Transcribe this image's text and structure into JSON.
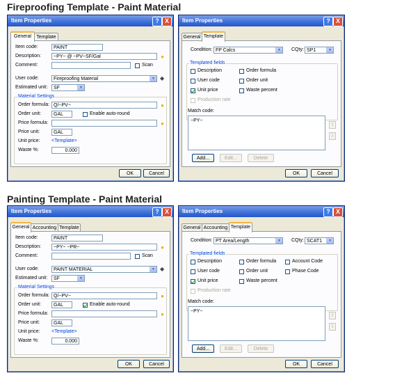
{
  "sections": {
    "fireproofing_title": "Fireproofing Template - Paint Material",
    "painting_title": "Painting Template - Paint Material"
  },
  "window_title": "Item Properties",
  "titlebar_buttons": {
    "help": "?",
    "close": "X"
  },
  "icons": {
    "help": "question-mark",
    "close": "x-close",
    "bulb": "lightbulb-icon",
    "pencil": "edit-pencil-icon",
    "up": "arrow-up-icon",
    "down": "arrow-down-icon",
    "dropdown": "chevron-down-icon"
  },
  "colors": {
    "titlebar": "#2556c9",
    "group_label": "#0046d5",
    "active_tab_accent": "#f5b53c",
    "dialog_bg": "#ece9d8"
  },
  "fp_general": {
    "tabs": [
      "General",
      "Template"
    ],
    "labels": {
      "item_code": "Item code:",
      "description": "Description:",
      "comment": "Comment:",
      "scan": "Scan",
      "user_code": "User code:",
      "estimated_unit": "Estimated unit:",
      "material_settings": "Material Settings",
      "order_formula": "Order formula:",
      "order_unit": "Order unit:",
      "enable_autoround": "Enable auto-round",
      "price_formula": "Price formula:",
      "price_unit": "Price unit:",
      "unit_price": "Unit price:",
      "waste": "Waste %:"
    },
    "values": {
      "item_code": "PAINT",
      "description": "~PY~ @ ~PV~SF/Gal",
      "comment": "",
      "user_code": "Fireproofing Material",
      "estimated_unit": "SF",
      "order_formula": "Q/~PV~",
      "order_unit": "GAL",
      "price_formula": "",
      "price_unit": "GAL",
      "unit_price": "<Template>",
      "waste": "0.000"
    },
    "checks": {
      "scan": false,
      "enable_autoround": false
    },
    "buttons": {
      "ok": "OK",
      "cancel": "Cancel"
    }
  },
  "fp_template": {
    "tabs": [
      "General",
      "Template"
    ],
    "labels": {
      "condition": "Condition:",
      "cqty": "CQty:",
      "templated_fields": "Templated fields",
      "description": "Description",
      "order_formula": "Order formula",
      "user_code": "User code",
      "order_unit": "Order unit",
      "unit_price": "Unit price",
      "waste_percent": "Waste percent",
      "production_rate": "Production rate",
      "match_code": "Match code:"
    },
    "values": {
      "condition": "FP Calcs",
      "cqty": "SP1",
      "match_code": "~PY~"
    },
    "checks": {
      "description": false,
      "order_formula": false,
      "user_code": false,
      "order_unit": false,
      "unit_price": true,
      "waste_percent": false,
      "production_rate": false
    },
    "buttons": {
      "add": "Add...",
      "edit": "Edit...",
      "delete": "Delete",
      "ok": "OK",
      "cancel": "Cancel"
    }
  },
  "pt_general": {
    "tabs": [
      "General",
      "Accounting",
      "Template"
    ],
    "labels": {
      "item_code": "Item code:",
      "description": "Description:",
      "comment": "Comment:",
      "scan": "Scan",
      "user_code": "User code:",
      "estimated_unit": "Estimated unit:",
      "material_settings": "Material Settings",
      "order_formula": "Order formula:",
      "order_unit": "Order unit:",
      "enable_autoround": "Enable auto-round",
      "price_formula": "Price formula:",
      "price_unit": "Price unit:",
      "unit_price": "Unit price:",
      "waste": "Waste %:"
    },
    "values": {
      "item_code": "PAINT",
      "description": "~PY~ ~PR~",
      "comment": "",
      "user_code": "PAINT MATERIAL",
      "estimated_unit": "SF",
      "order_formula": "Q/~PV~",
      "order_unit": "GAL",
      "price_formula": "",
      "price_unit": "GAL",
      "unit_price": "<Template>",
      "waste": "0.000"
    },
    "checks": {
      "scan": false,
      "enable_autoround": true
    },
    "buttons": {
      "ok": "OK",
      "cancel": "Cancel"
    }
  },
  "pt_template": {
    "tabs": [
      "General",
      "Accounting",
      "Template"
    ],
    "labels": {
      "condition": "Condition:",
      "cqty": "CQty:",
      "templated_fields": "Templated fields",
      "description": "Description",
      "order_formula": "Order formula",
      "account_code": "Account Code",
      "user_code": "User code",
      "order_unit": "Order unit",
      "phase_code": "Phase Code",
      "unit_price": "Unit price",
      "waste_percent": "Waste percent",
      "production_rate": "Production rate",
      "match_code": "Match code:"
    },
    "values": {
      "condition": "PT Area/Length",
      "cqty": "SCAT1",
      "match_code": "~PY~"
    },
    "checks": {
      "description": false,
      "order_formula": false,
      "account_code": false,
      "user_code": false,
      "order_unit": false,
      "phase_code": false,
      "unit_price": true,
      "waste_percent": false,
      "production_rate": false
    },
    "buttons": {
      "add": "Add...",
      "edit": "Edit...",
      "delete": "Delete",
      "ok": "OK",
      "cancel": "Cancel"
    }
  }
}
